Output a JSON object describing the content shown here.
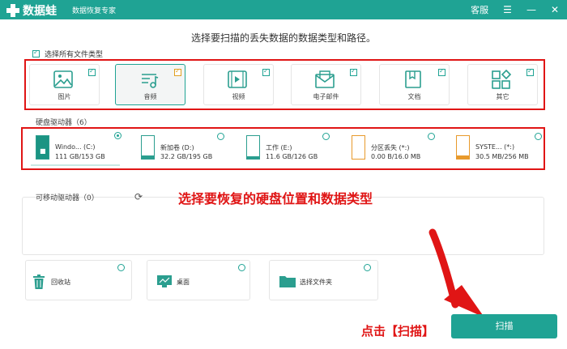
{
  "titlebar": {
    "app_name": "数据蛙",
    "subtitle": "数据恢复专家",
    "support": "客服",
    "menu_icon": "menu-icon",
    "minimize_icon": "minimize-icon",
    "close_icon": "close-icon"
  },
  "heading": "选择要扫描的丢失数据的数据类型和路径。",
  "select_all": "选择所有文件类型",
  "file_types": [
    {
      "label": "图片",
      "icon": "image-icon",
      "checked": true
    },
    {
      "label": "音频",
      "icon": "audio-icon",
      "checked": true
    },
    {
      "label": "视频",
      "icon": "video-icon",
      "checked": true
    },
    {
      "label": "电子邮件",
      "icon": "email-icon",
      "checked": true
    },
    {
      "label": "文档",
      "icon": "document-icon",
      "checked": true
    },
    {
      "label": "其它",
      "icon": "other-icon",
      "checked": true
    }
  ],
  "hard_drives": {
    "label": "硬盘驱动器（6）",
    "items": [
      {
        "name": "Windo... (C:)",
        "size": "111 GB/153 GB",
        "selected": true
      },
      {
        "name": "新加卷 (D:)",
        "size": "32.2 GB/195 GB",
        "selected": false
      },
      {
        "name": "工作 (E:)",
        "size": "11.6 GB/126 GB",
        "selected": false
      },
      {
        "name": "分区丢失 (*:)",
        "size": "0.00  B/16.0 MB",
        "selected": false
      },
      {
        "name": "SYSTE... (*:)",
        "size": "30.5 MB/256 MB",
        "selected": false
      }
    ]
  },
  "removable": {
    "label": "可移动驱动器（0）"
  },
  "annotation": "选择要恢复的硬盘位置和数据类型",
  "locations": [
    {
      "label": "回收站",
      "icon": "recycle-bin-icon"
    },
    {
      "label": "桌面",
      "icon": "desktop-icon"
    },
    {
      "label": "选择文件夹",
      "icon": "folder-icon"
    }
  ],
  "scan_annotation": "点击【扫描】",
  "scan_button": "扫描",
  "colors": {
    "accent": "#1fa394",
    "annotation": "#e01515",
    "orange": "#e89a2c"
  }
}
